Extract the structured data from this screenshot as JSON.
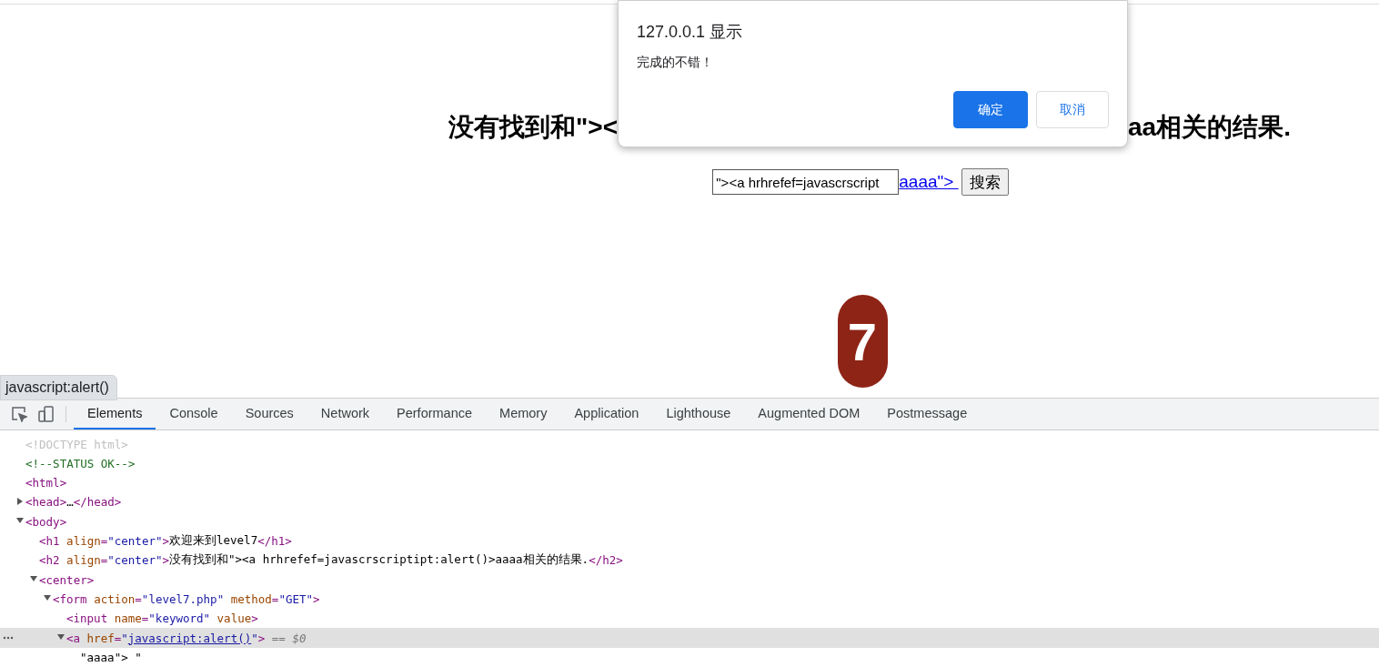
{
  "page": {
    "heading_left": "没有找到和\"><",
    "heading_right": "aa相关的结果.",
    "search": {
      "value": "\"><a hrhrefef=javascrscript",
      "link": "aaaa\"> ",
      "button": "搜索"
    },
    "level_badge": "7"
  },
  "dialog": {
    "title": "127.0.0.1 显示",
    "message": "完成的不错！",
    "buttons": [
      {
        "label": "确定",
        "selected": true
      },
      {
        "label": "取消",
        "selected": false
      }
    ]
  },
  "status_tooltip": "javascript:alert()",
  "devtools": {
    "tabs": [
      {
        "label": "Elements",
        "selected": true
      },
      {
        "label": "Console",
        "selected": false
      },
      {
        "label": "Sources",
        "selected": false
      },
      {
        "label": "Network",
        "selected": false
      },
      {
        "label": "Performance",
        "selected": false
      },
      {
        "label": "Memory",
        "selected": false
      },
      {
        "label": "Application",
        "selected": false
      },
      {
        "label": "Lighthouse",
        "selected": false
      },
      {
        "label": "Augmented DOM",
        "selected": false
      },
      {
        "label": "Postmessage",
        "selected": false
      }
    ],
    "tree": [
      {
        "tokens": [
          {
            "kind": "doctype",
            "text": "<!DOCTYPE html>"
          }
        ]
      },
      {
        "tokens": [
          {
            "kind": "comment",
            "text": "<!--STATUS OK-->"
          }
        ]
      },
      {
        "tokens": [
          {
            "kind": "tag",
            "text": "<html>"
          }
        ]
      },
      {
        "expanded": false,
        "tokens": [
          {
            "kind": "tag",
            "text": "<head>"
          },
          {
            "kind": "text",
            "text": "…"
          },
          {
            "kind": "tag",
            "text": "</head>"
          }
        ]
      },
      {
        "expanded": true,
        "tokens": [
          {
            "kind": "tag",
            "text": "<body>"
          }
        ],
        "children": [
          {
            "tokens": [
              {
                "kind": "tag",
                "text": "<h1"
              },
              {
                "kind": "attr",
                "text": " align"
              },
              {
                "kind": "tag",
                "text": "="
              },
              {
                "kind": "value",
                "text": "\"center\""
              },
              {
                "kind": "tag",
                "text": ">"
              },
              {
                "kind": "text",
                "text": "欢迎来到level7"
              },
              {
                "kind": "tag",
                "text": "</h1>"
              }
            ]
          },
          {
            "tokens": [
              {
                "kind": "tag",
                "text": "<h2"
              },
              {
                "kind": "attr",
                "text": " align"
              },
              {
                "kind": "tag",
                "text": "="
              },
              {
                "kind": "value",
                "text": "\"center\""
              },
              {
                "kind": "tag",
                "text": ">"
              },
              {
                "kind": "text",
                "text": "没有找到和\"><a hrhrefef=javascrscriptipt:alert()>aaaa相关的结果."
              },
              {
                "kind": "tag",
                "text": "</h2>"
              }
            ]
          },
          {
            "expanded": true,
            "tokens": [
              {
                "kind": "tag",
                "text": "<center>"
              }
            ],
            "children": [
              {
                "expanded": true,
                "tokens": [
                  {
                    "kind": "tag",
                    "text": "<form"
                  },
                  {
                    "kind": "attr",
                    "text": " action"
                  },
                  {
                    "kind": "tag",
                    "text": "="
                  },
                  {
                    "kind": "value",
                    "text": "\"level7.php\""
                  },
                  {
                    "kind": "attr",
                    "text": " method"
                  },
                  {
                    "kind": "tag",
                    "text": "="
                  },
                  {
                    "kind": "value",
                    "text": "\"GET\""
                  },
                  {
                    "kind": "tag",
                    "text": ">"
                  }
                ],
                "children": [
                  {
                    "tokens": [
                      {
                        "kind": "tag",
                        "text": "<input"
                      },
                      {
                        "kind": "attr",
                        "text": " name"
                      },
                      {
                        "kind": "tag",
                        "text": "="
                      },
                      {
                        "kind": "value",
                        "text": "\"keyword\""
                      },
                      {
                        "kind": "attr",
                        "text": " value"
                      },
                      {
                        "kind": "tag",
                        "text": ">"
                      }
                    ]
                  },
                  {
                    "expanded": true,
                    "selected": true,
                    "tokens": [
                      {
                        "kind": "tag",
                        "text": "<a"
                      },
                      {
                        "kind": "attr",
                        "text": " href"
                      },
                      {
                        "kind": "tag",
                        "text": "="
                      },
                      {
                        "kind": "value",
                        "text": "\""
                      },
                      {
                        "kind": "link",
                        "text": "javascript:alert()"
                      },
                      {
                        "kind": "value",
                        "text": "\""
                      },
                      {
                        "kind": "tag",
                        "text": ">"
                      },
                      {
                        "kind": "hint",
                        "text": " == $0"
                      }
                    ],
                    "children": [
                      {
                        "tokens": [
                          {
                            "kind": "text",
                            "text": "\"aaaa\"> \""
                          }
                        ]
                      }
                    ]
                  }
                ]
              }
            ]
          }
        ]
      }
    ]
  }
}
